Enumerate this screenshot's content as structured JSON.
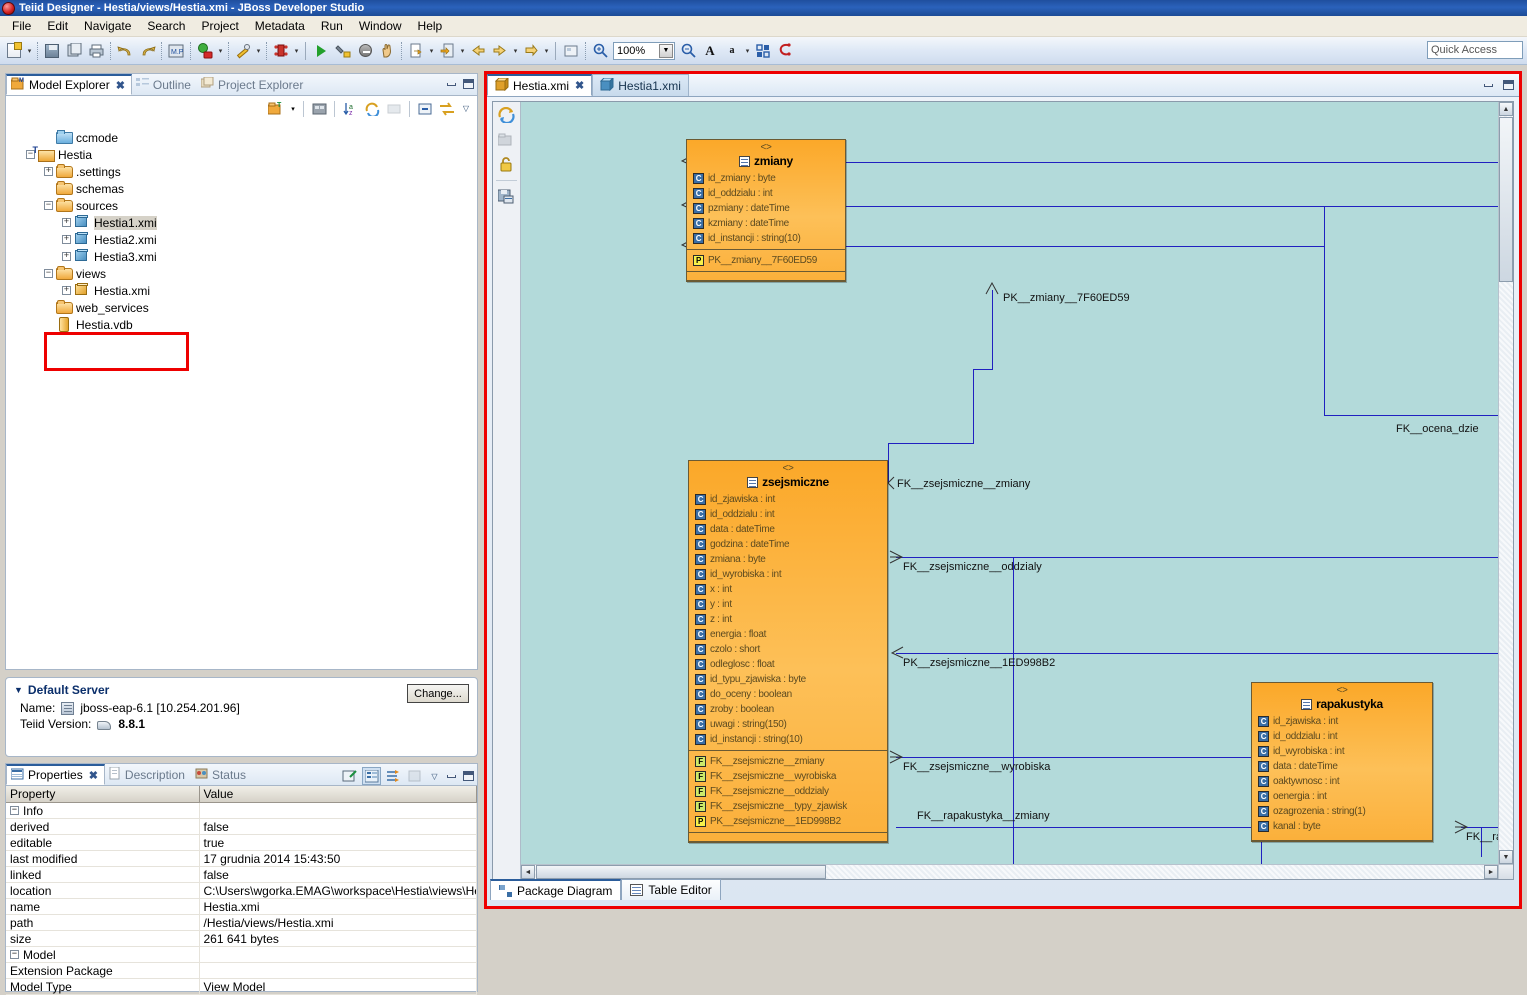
{
  "window": {
    "title": "Teiid Designer - Hestia/views/Hestia.xmi - JBoss Developer Studio",
    "icon": "teiid-app-icon"
  },
  "menubar": {
    "items": [
      "File",
      "Edit",
      "Navigate",
      "Search",
      "Project",
      "Metadata",
      "Run",
      "Window",
      "Help"
    ]
  },
  "toolbar": {
    "zoom_value": "100%",
    "quick_access_placeholder": "Quick Access",
    "icons": [
      "new-wizard-icon",
      "save-icon",
      "save-all-icon",
      "print-icon",
      "undo-icon",
      "redo-icon",
      "preview-data-icon",
      "execute-vdb-icon",
      "validate-icon",
      "debug-icon",
      "run-icon",
      "build-icon",
      "terminate-icon",
      "pan-icon",
      "import-icon",
      "export-icon",
      "back-icon",
      "forward-icon",
      "next-icon",
      "new-diagram-icon",
      "zoom-in-icon",
      "zoom-out-icon",
      "font-larger-icon",
      "font-smaller-icon",
      "align-icon",
      "clear-icon"
    ]
  },
  "model_explorer": {
    "tabs": [
      {
        "label": "Model Explorer",
        "icon": "model-explorer-icon",
        "active": true,
        "closeable": true
      },
      {
        "label": "Outline",
        "icon": "outline-icon",
        "active": false,
        "closeable": false
      },
      {
        "label": "Project Explorer",
        "icon": "project-explorer-icon",
        "active": false,
        "closeable": false
      }
    ],
    "view_toolbar_icons": [
      "new-model-icon",
      "dropdown-arrow-icon",
      "build-imports-icon",
      "sort-az-icon",
      "refresh-icon",
      "link-editor-icon",
      "collapse-all-icon",
      "link-selection-icon",
      "view-menu-icon"
    ],
    "tree": [
      {
        "label": "ccmode",
        "icon": "folder-blue-icon",
        "indent": 1,
        "expander": "none",
        "selected": false
      },
      {
        "label": "Hestia",
        "icon": "teiid-project-icon",
        "indent": 0,
        "expander": "minus",
        "selected": false
      },
      {
        "label": ".settings",
        "icon": "folder-icon",
        "indent": 1,
        "expander": "plus",
        "selected": false
      },
      {
        "label": "schemas",
        "icon": "folder-icon",
        "indent": 1,
        "expander": "none",
        "selected": false
      },
      {
        "label": "sources",
        "icon": "folder-icon",
        "indent": 1,
        "expander": "minus",
        "selected": false
      },
      {
        "label": "Hestia1.xmi",
        "icon": "source-model-icon",
        "indent": 2,
        "expander": "plus",
        "selected": true
      },
      {
        "label": "Hestia2.xmi",
        "icon": "source-model-icon",
        "indent": 2,
        "expander": "plus",
        "selected": false
      },
      {
        "label": "Hestia3.xmi",
        "icon": "source-model-icon",
        "indent": 2,
        "expander": "plus",
        "selected": false
      },
      {
        "label": "views",
        "icon": "folder-icon",
        "indent": 1,
        "expander": "minus",
        "selected": false
      },
      {
        "label": "Hestia.xmi",
        "icon": "view-model-icon",
        "indent": 2,
        "expander": "plus",
        "selected": false
      },
      {
        "label": "web_services",
        "icon": "folder-icon",
        "indent": 1,
        "expander": "none",
        "selected": false
      },
      {
        "label": "Hestia.vdb",
        "icon": "vdb-icon",
        "indent": 1,
        "expander": "none",
        "selected": false
      }
    ],
    "highlight_note": "red-box-around-views-and-hestia-xmi"
  },
  "default_server": {
    "section_title": "Default Server",
    "change_button": "Change...",
    "name_label": "Name:",
    "name_value": "jboss-eap-6.1 [10.254.201.96]",
    "version_label": "Teiid Version:",
    "version_value": "8.8.1"
  },
  "properties": {
    "tabs": [
      {
        "label": "Properties",
        "icon": "properties-icon",
        "active": true,
        "closeable": true
      },
      {
        "label": "Description",
        "icon": "description-icon",
        "active": false,
        "closeable": false
      },
      {
        "label": "Status",
        "icon": "status-icon",
        "active": false,
        "closeable": false
      }
    ],
    "toolbar_icons": [
      "new-property-icon",
      "categorized-view-icon",
      "advanced-filter-icon",
      "restore-defaults-icon",
      "view-menu-icon"
    ],
    "columns": [
      "Property",
      "Value"
    ],
    "groups": [
      {
        "name": "Info",
        "rows": [
          {
            "key": "derived",
            "value": "false"
          },
          {
            "key": "editable",
            "value": "true"
          },
          {
            "key": "last modified",
            "value": "17 grudnia 2014 15:43:50"
          },
          {
            "key": "linked",
            "value": "false"
          },
          {
            "key": "location",
            "value": "C:\\Users\\wgorka.EMAG\\workspace\\Hestia\\views\\He..."
          },
          {
            "key": "name",
            "value": "Hestia.xmi"
          },
          {
            "key": "path",
            "value": "/Hestia/views/Hestia.xmi"
          },
          {
            "key": "size",
            "value": "261 641  bytes"
          }
        ]
      },
      {
        "name": "Model",
        "rows": [
          {
            "key": "Extension Package",
            "value": ""
          },
          {
            "key": "Model Type",
            "value": "View Model"
          }
        ]
      }
    ]
  },
  "editor": {
    "tabs": [
      {
        "label": "Hestia.xmi",
        "icon": "view-model-icon",
        "active": true,
        "closeable": true
      },
      {
        "label": "Hestia1.xmi",
        "icon": "source-model-icon",
        "active": false,
        "closeable": false
      }
    ],
    "bottom_tabs": [
      {
        "label": "Package Diagram",
        "icon": "package-diagram-icon",
        "active": true
      },
      {
        "label": "Table Editor",
        "icon": "table-editor-icon",
        "active": false
      }
    ],
    "palette_icons": [
      "refresh-diagram-icon",
      "show-package-icon",
      "lock-icon",
      "save-diagram-icon"
    ],
    "minimize_icon": "minimize-icon",
    "maximize_icon": "maximize-icon"
  },
  "diagram": {
    "canvas_color": "#b3dada",
    "line_color": "#2020c0",
    "tables": [
      {
        "name": "zmiany",
        "stereotype": "<<Table>>",
        "columns": [
          "id_zmiany : byte",
          "id_oddzialu : int",
          "pzmiany : dateTime",
          "kzmiany : dateTime",
          "id_instancji : string(10)"
        ],
        "keys": [
          {
            "kind": "P",
            "label": "PK__zmiany__7F60ED59"
          }
        ]
      },
      {
        "name": "zsejsmiczne",
        "stereotype": "<<Table>>",
        "columns": [
          "id_zjawiska : int",
          "id_oddzialu : int",
          "data : dateTime",
          "godzina : dateTime",
          "zmiana : byte",
          "id_wyrobiska : int",
          "x : int",
          "y : int",
          "z : int",
          "energia : float",
          "czolo : short",
          "odleglosc : float",
          "id_typu_zjawiska : byte",
          "do_oceny : boolean",
          "zroby : boolean",
          "uwagi : string(150)",
          "id_instancji : string(10)"
        ],
        "keys": [
          {
            "kind": "F",
            "label": "FK__zsejsmiczne__zmiany"
          },
          {
            "kind": "F",
            "label": "FK__zsejsmiczne__wyrobiska"
          },
          {
            "kind": "F",
            "label": "FK__zsejsmiczne__oddzialy"
          },
          {
            "kind": "F",
            "label": "FK__zsejsmiczne__typy_zjawisk"
          },
          {
            "kind": "P",
            "label": "PK__zsejsmiczne__1ED998B2"
          }
        ]
      },
      {
        "name": "rapakustyka",
        "stereotype": "<<Table>>",
        "columns": [
          "id_zjawiska : int",
          "id_oddzialu : int",
          "id_wyrobiska : int",
          "data : dateTime",
          "oaktywnosc : int",
          "oenergia : int",
          "ozagrozenia : string(1)",
          "kanal : byte"
        ],
        "keys": []
      }
    ],
    "relationship_labels": [
      "PK__zmiany__7F60ED59",
      "PK__zmiany__7F60ED59",
      "PK__zmiany__7F60ED59",
      "PK__zmiany__7F60ED59",
      "FK__zsejsmiczne__zmiany",
      "FK__ocena_dzie",
      "FK__zsejsmiczne__oddzialy",
      "PK__zsejsmiczne__1ED998B2",
      "FK__zsejsmiczne__wyrobiska",
      "FK__rapakustyka__zmiany",
      "FK__rap"
    ]
  }
}
